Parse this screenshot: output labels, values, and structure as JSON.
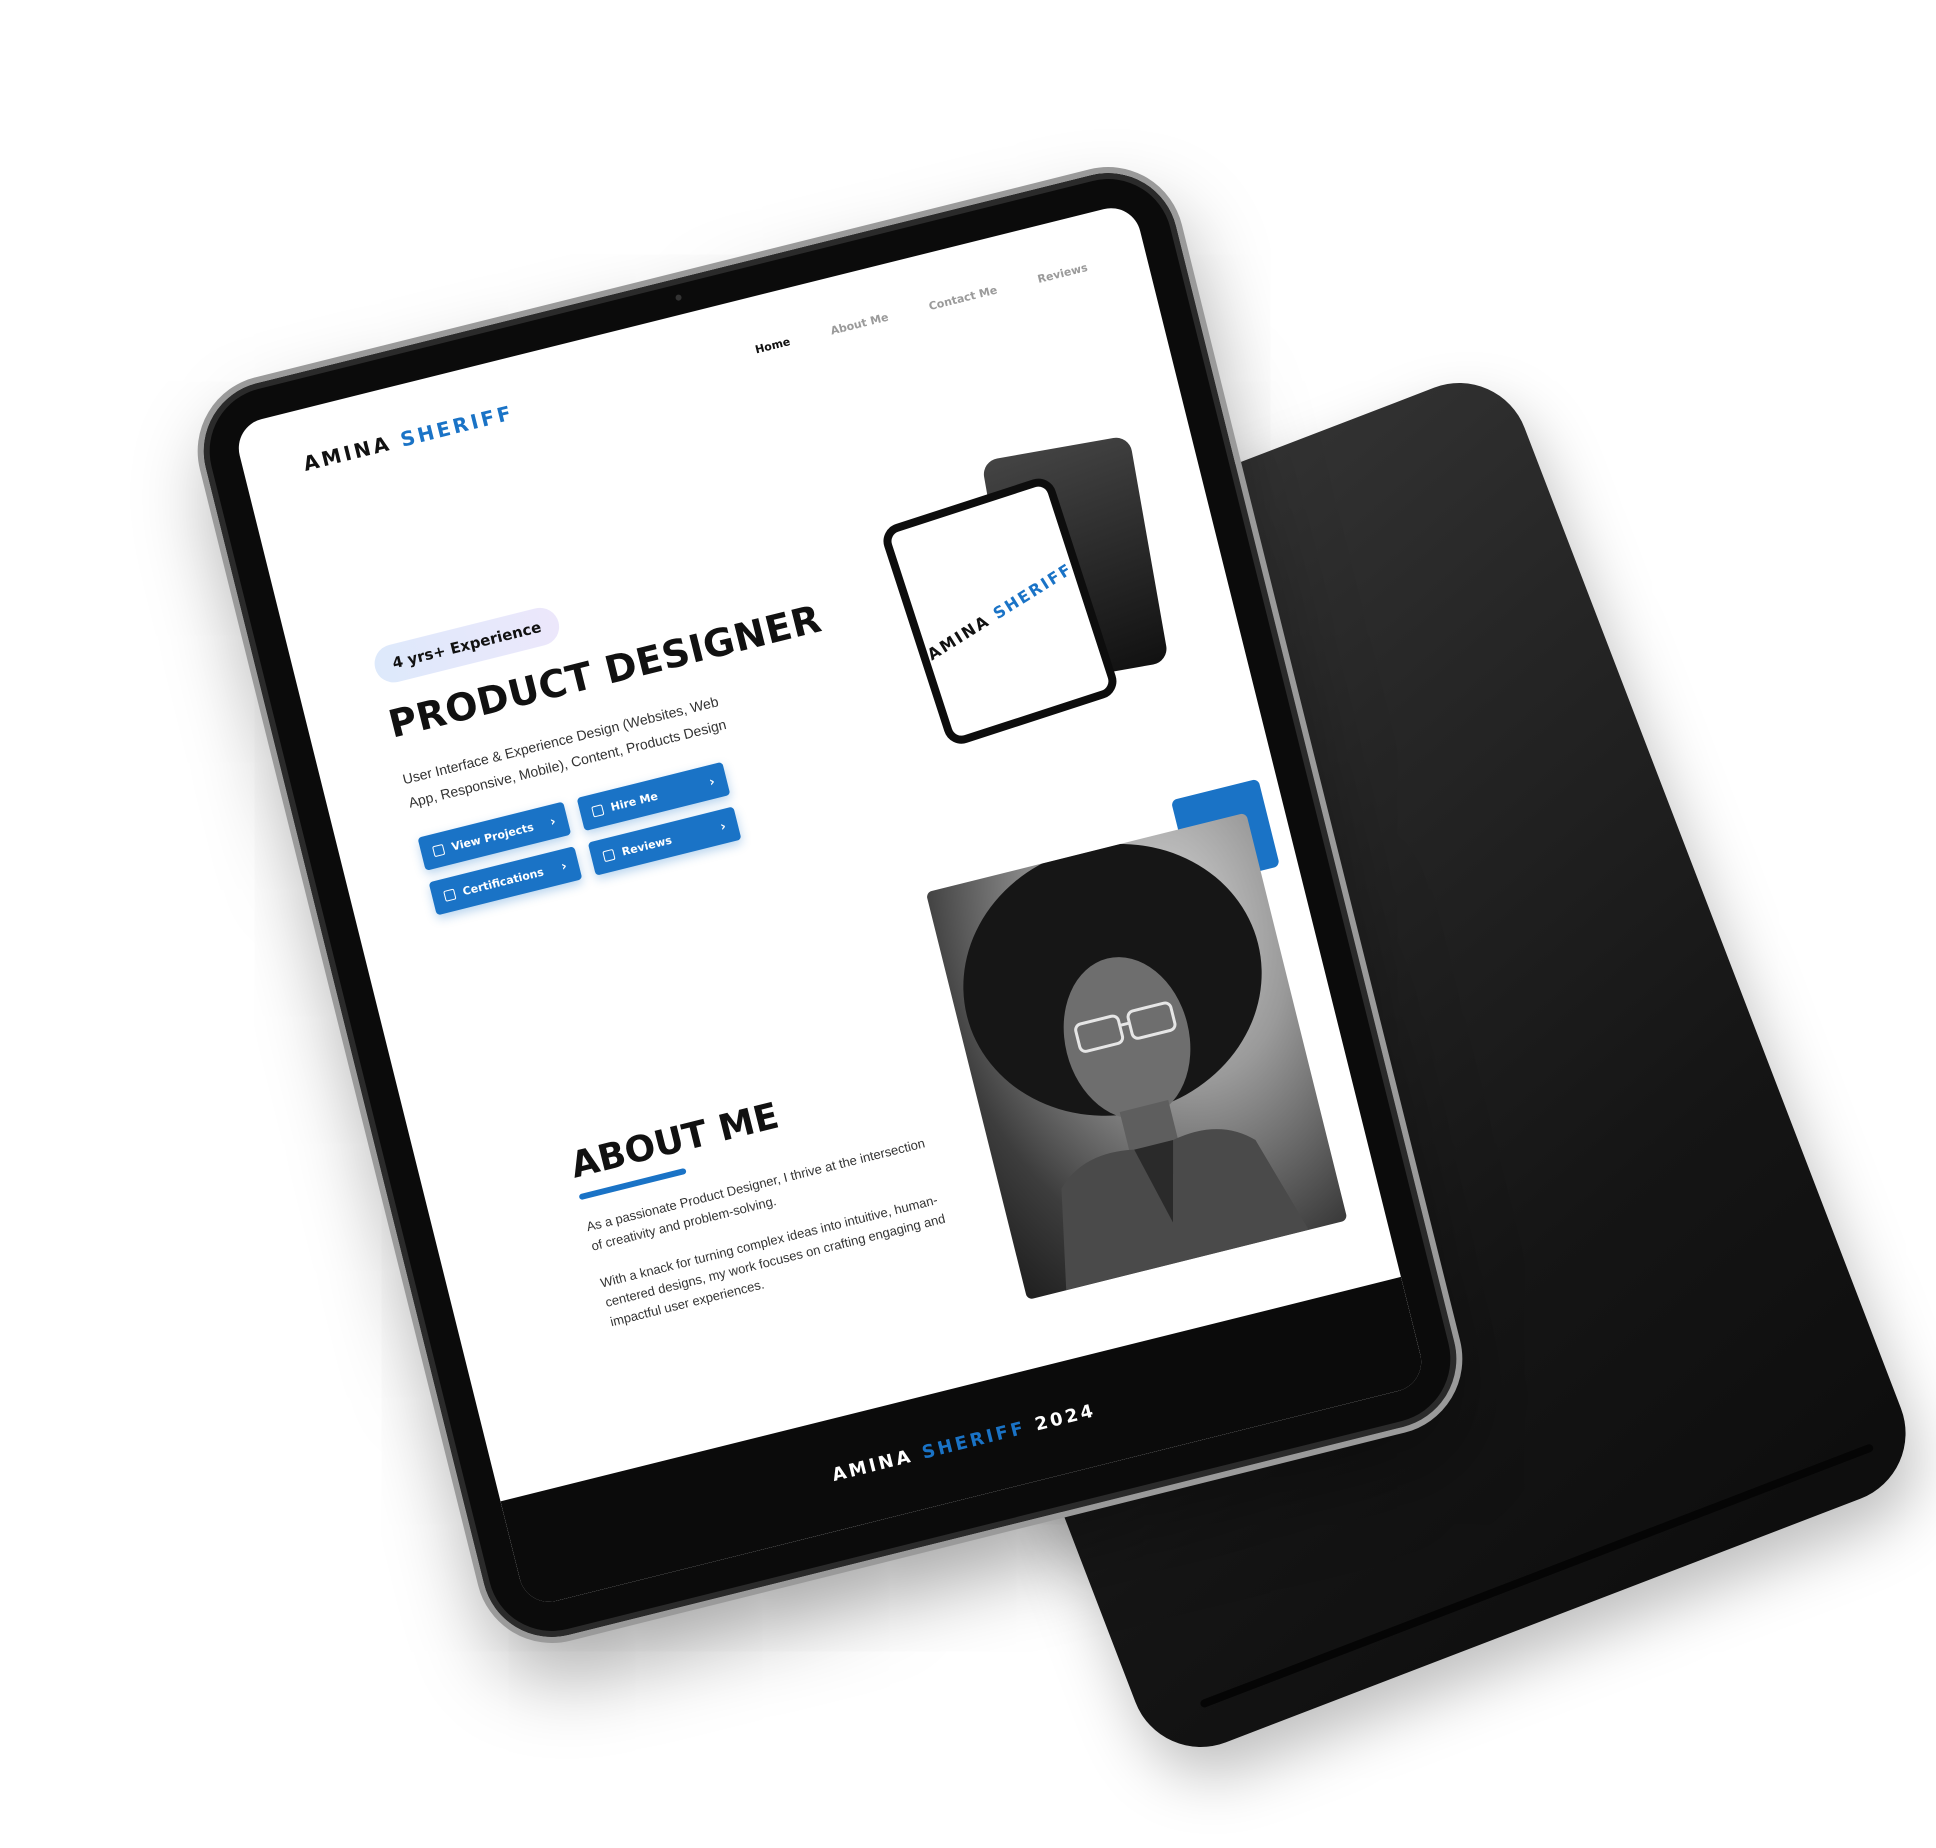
{
  "site": {
    "brand_first": "AMINA",
    "brand_last": "SHERIFF"
  },
  "nav": {
    "items": [
      {
        "label": "Home",
        "active": true
      },
      {
        "label": "About Me",
        "active": false
      },
      {
        "label": "Contact Me",
        "active": false
      },
      {
        "label": "Reviews",
        "active": false
      }
    ]
  },
  "hero": {
    "badge": "4 yrs+ Experience",
    "title": "PRODUCT DESIGNER",
    "description": "User Interface & Experience Design (Websites, Web App, Responsive, Mobile), Content, Products Design",
    "buttons": [
      {
        "label": "View Projects",
        "icon": "projects-icon"
      },
      {
        "label": "Hire Me",
        "icon": "briefcase-icon"
      },
      {
        "label": "Certifications",
        "icon": "certificate-icon"
      },
      {
        "label": "Reviews",
        "icon": "reviews-icon"
      }
    ]
  },
  "mini_device": {
    "brand_first": "AMINA",
    "brand_last": "SHERIFF"
  },
  "about": {
    "title": "ABOUT ME",
    "paragraph_1": "As a passionate Product Designer, I thrive at the intersection of creativity and problem-solving.",
    "paragraph_2": "With a knack for turning complex ideas into intuitive, human-centered designs, my work focuses on crafting engaging and impactful user experiences."
  },
  "footer": {
    "brand_first": "AMINA",
    "brand_last": "SHERIFF",
    "year": "2024"
  },
  "colors": {
    "accent": "#1a73c6",
    "text": "#111111",
    "device": "#0b0b0b"
  }
}
